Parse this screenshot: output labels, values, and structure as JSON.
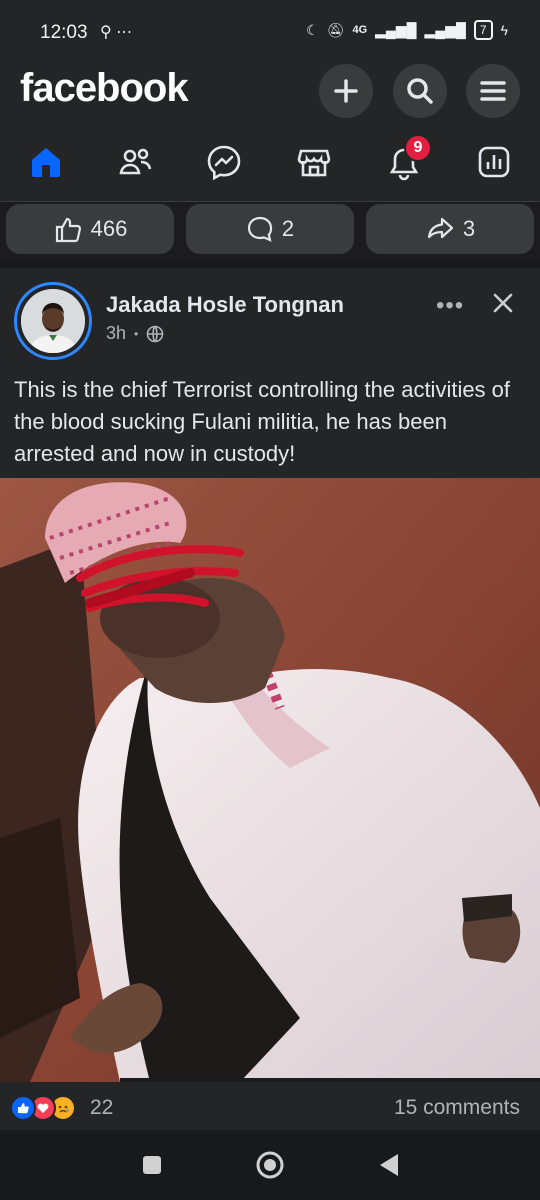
{
  "status_bar": {
    "time": "12:03",
    "left_icons": "⚲ ⋯",
    "network": "4G",
    "battery": "7"
  },
  "header": {
    "logo": "facebook",
    "buttons": [
      "plus-icon",
      "search-icon",
      "menu-icon"
    ]
  },
  "tabs": {
    "items": [
      "home-icon",
      "friends-icon",
      "messenger-icon",
      "marketplace-icon",
      "notifications-icon",
      "dashboard-icon"
    ],
    "notifications_badge": "9"
  },
  "prev_post_actions": {
    "like_count": "466",
    "comment_count": "2",
    "share_count": "3"
  },
  "post": {
    "author": "Jakada Hosle Tongnan",
    "time": "3h",
    "separator": "•",
    "privacy_icon": "globe-icon",
    "more": "•••",
    "text": "This is the chief Terrorist controlling the activities of the blood sucking Fulani militia, he has been arrested and now in custody!",
    "reaction_count": "22",
    "comments": "15 comments"
  },
  "colors": {
    "brand_blue": "#0866ff",
    "badge_red": "#e41e3f",
    "bg": "#242526"
  }
}
